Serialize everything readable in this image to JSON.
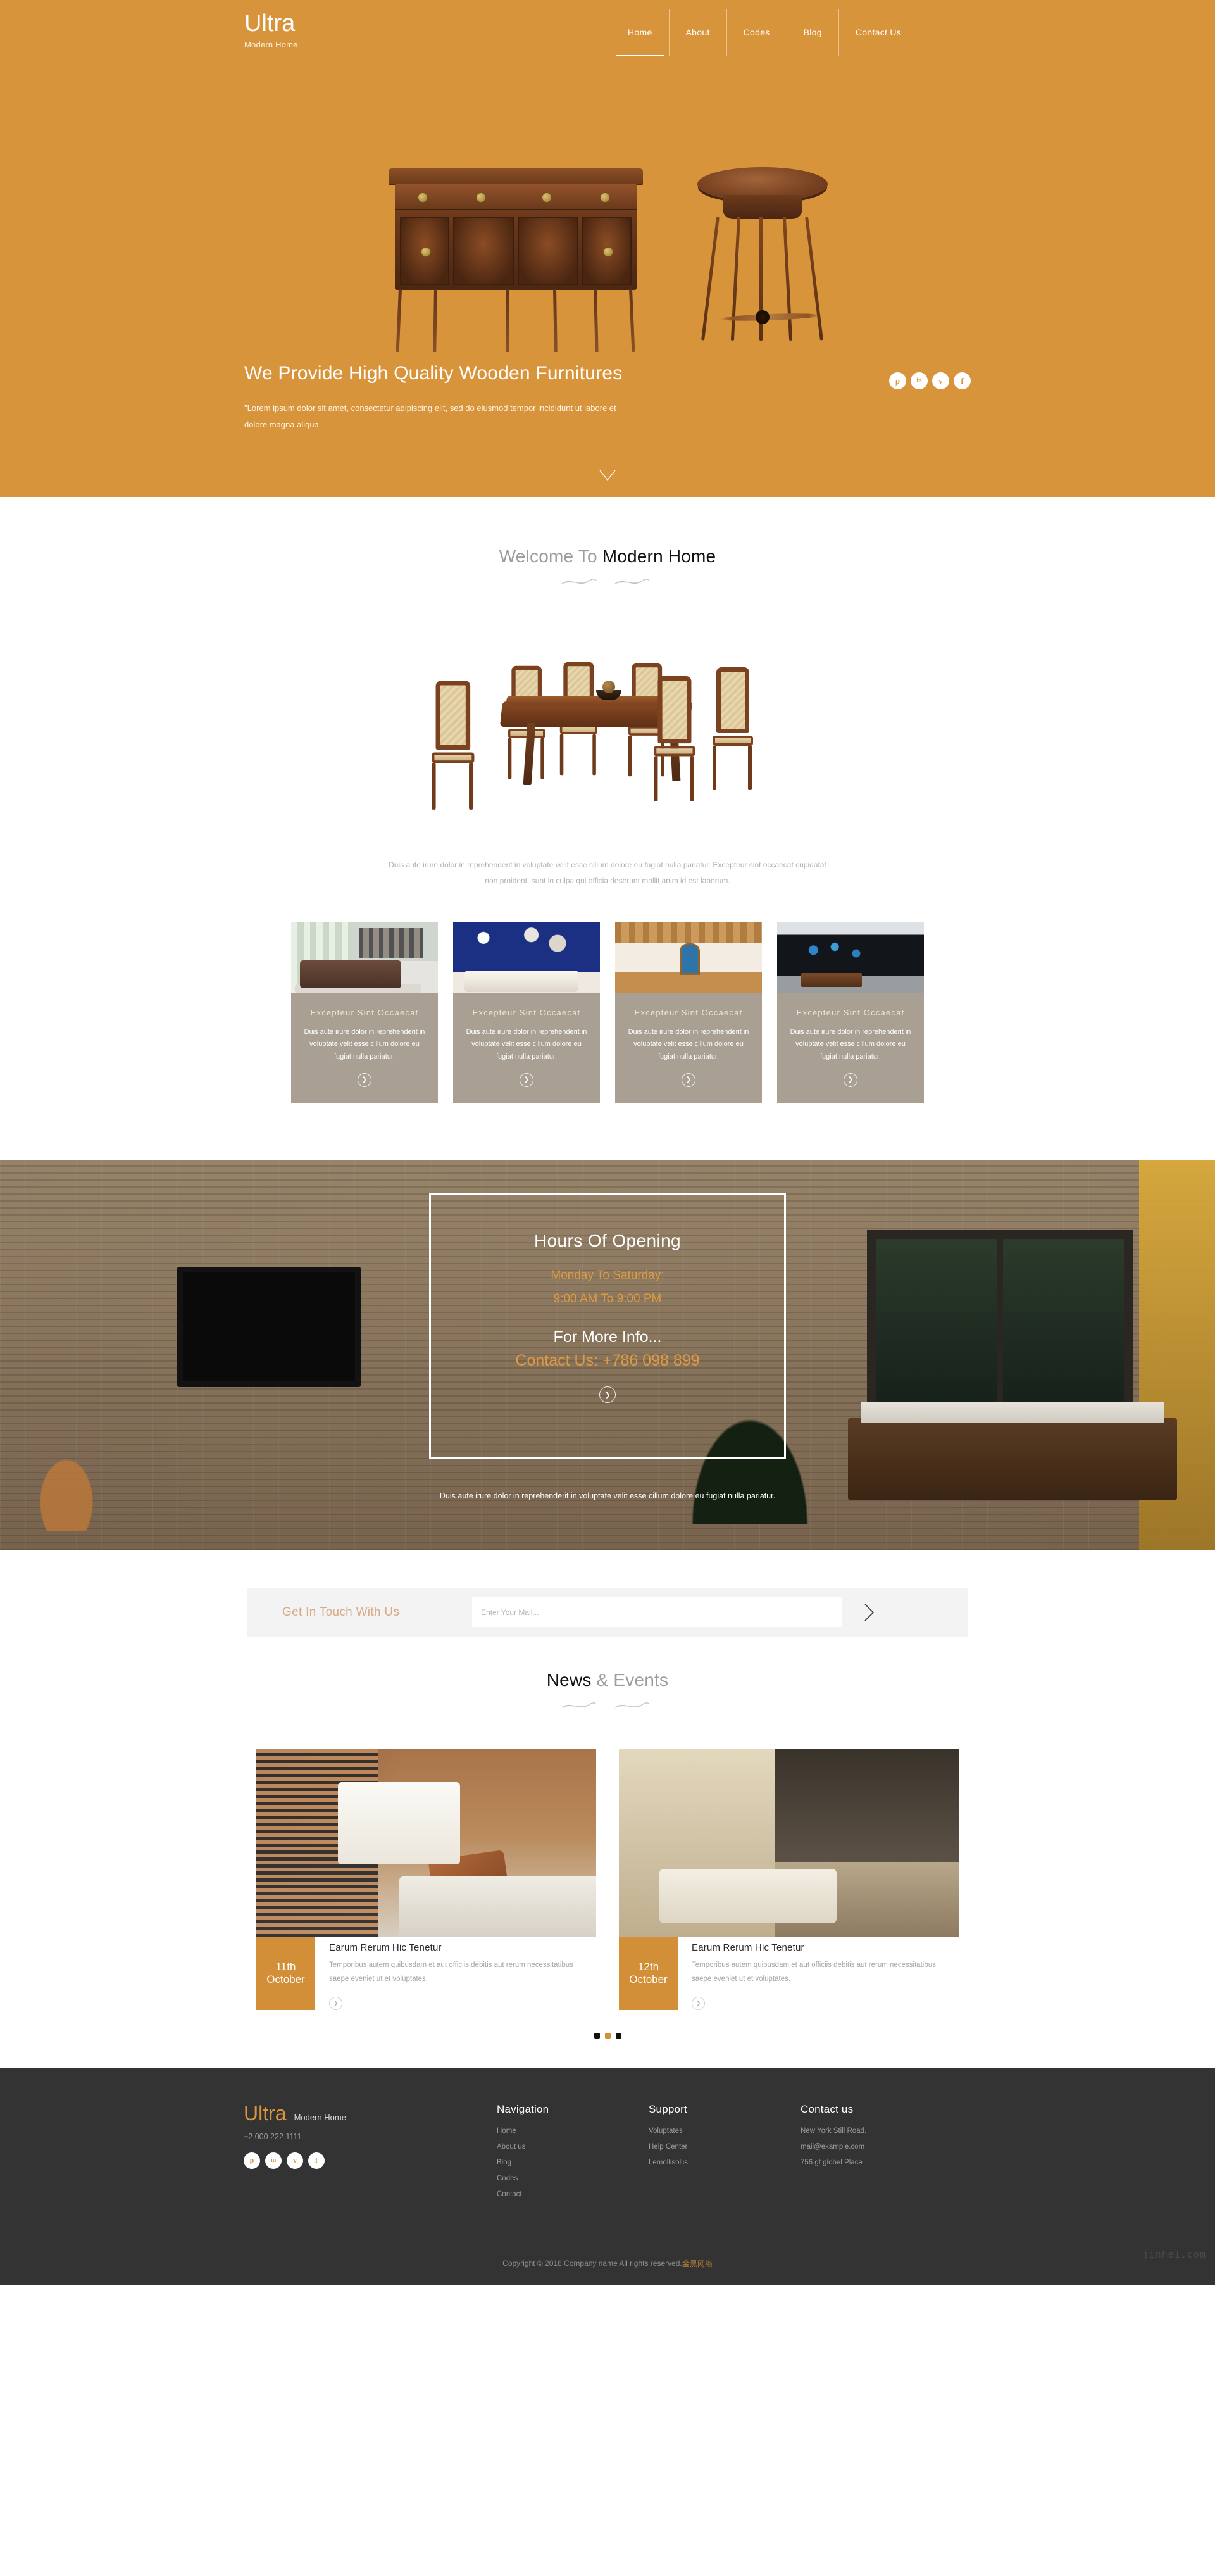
{
  "header": {
    "brand": "Ultra",
    "brand_sub": "Modern Home",
    "nav": [
      {
        "label": "Home",
        "active": true
      },
      {
        "label": "About",
        "active": false
      },
      {
        "label": "Codes",
        "active": false
      },
      {
        "label": "Blog",
        "active": false
      },
      {
        "label": "Contact Us",
        "active": false
      }
    ]
  },
  "hero": {
    "title": "We Provide High Quality Wooden Furnitures",
    "subtitle": "\"Lorem ipsum dolor sit amet, consectetur adipiscing elit, sed do eiusmod tempor incididunt ut labore et dolore magna aliqua.",
    "social": [
      {
        "name": "pinterest-icon",
        "glyph": "р"
      },
      {
        "name": "linkedin-icon",
        "glyph": "in"
      },
      {
        "name": "vimeo-icon",
        "glyph": "v"
      },
      {
        "name": "facebook-icon",
        "glyph": "f"
      }
    ],
    "scroll_hint": "scroll-down-chevron",
    "background_color": "#d8943a"
  },
  "welcome": {
    "title_light": "Welcome To",
    "title_bold": "Modern Home",
    "paragraph": "Duis aute irure dolor in reprehenderit in voluptate velit esse cillum dolore eu fugiat nulla pariatur. Excepteur sint occaecat cupidatat non proident, sunt in culpa qui officia deserunt mollit anim id est laborum.",
    "cards": [
      {
        "title": "Excepteur Sint Occaecat",
        "text": "Duis aute irure dolor in reprehenderit in voluptate velit esse cillum dolore eu fugiat nulla pariatur.",
        "image_alt": "brown-leather-sofa-living-room"
      },
      {
        "title": "Excepteur Sint Occaecat",
        "text": "Duis aute irure dolor in reprehenderit in voluptate velit esse cillum dolore eu fugiat nulla pariatur.",
        "image_alt": "blue-wall-white-sofa-decor"
      },
      {
        "title": "Excepteur Sint Occaecat",
        "text": "Duis aute irure dolor in reprehenderit in voluptate velit esse cillum dolore eu fugiat nulla pariatur.",
        "image_alt": "wooden-attic-hallway"
      },
      {
        "title": "Excepteur Sint Occaecat",
        "text": "Duis aute irure dolor in reprehenderit in voluptate velit esse cillum dolore eu fugiat nulla pariatur.",
        "image_alt": "modern-media-room-screen"
      }
    ]
  },
  "hours": {
    "title": "Hours Of Opening",
    "days": "Monday To Saturday:",
    "time": "9:00 AM To 9:00 PM",
    "more_info": "For More Info...",
    "contact": "Contact Us: +786 098 899",
    "caption": "Duis aute irure dolor in reprehenderit in voluptate velit esse cillum dolore eu fugiat nulla pariatur."
  },
  "newsletter": {
    "label": "Get In Touch With Us",
    "placeholder": "Enter Your Mail...",
    "value": "",
    "submit_icon": "chevron-right-icon"
  },
  "news": {
    "title_bold": "News",
    "title_light": "& Events",
    "items": [
      {
        "day": "11th",
        "month": "October",
        "title": "Earum Rerum Hic Tenetur",
        "desc": "Temporibus autem quibusdam et aut officiis debitis aut rerum necessitatibus saepe eveniet ut et voluptates.",
        "image_alt": "cozy-wooden-bench-deer-pillow"
      },
      {
        "day": "12th",
        "month": "October",
        "title": "Earum Rerum Hic Tenetur",
        "desc": "Temporibus autem quibusdam et aut officiis debitis aut rerum necessitatibus saepe eveniet ut et voluptates.",
        "image_alt": "bedroom-with-map-wall"
      }
    ],
    "dots": [
      {
        "active": false
      },
      {
        "active": true
      },
      {
        "active": false
      }
    ]
  },
  "footer": {
    "brand": "Ultra",
    "brand_sub": "Modern Home",
    "phone": "+2 000 222 1111",
    "social": [
      {
        "name": "pinterest-icon",
        "glyph": "р"
      },
      {
        "name": "linkedin-icon",
        "glyph": "in"
      },
      {
        "name": "vimeo-icon",
        "glyph": "v"
      },
      {
        "name": "facebook-icon",
        "glyph": "f"
      }
    ],
    "columns": [
      {
        "heading": "Navigation",
        "items": [
          "Home",
          "About us",
          "Blog",
          "Codes",
          "Contact"
        ]
      },
      {
        "heading": "Support",
        "items": [
          "Voluptates",
          "Help Center",
          "Lemollisollis"
        ]
      },
      {
        "heading": "Contact us",
        "items": [
          "New York Still Road.",
          "mail@example.com",
          "756 gt globel Place"
        ]
      }
    ],
    "copyright": "Copyright © 2016.Company name All rights reserved.",
    "copyright_link": "金黑网络",
    "watermark": "jinhei.com"
  },
  "colors": {
    "accent": "#d8943a",
    "card_overlay": "#a9a093",
    "footer_bg": "#333333",
    "news_date_bg": "#d28f38"
  }
}
